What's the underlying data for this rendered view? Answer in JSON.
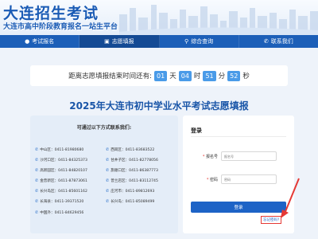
{
  "header": {
    "title": "大连招生考试",
    "subtitle": "大连市高中阶段教育报名一站生平台"
  },
  "nav": [
    {
      "label": "考试报名",
      "icon": "user-icon",
      "active": false
    },
    {
      "label": "志愿填报",
      "icon": "doc-icon",
      "active": true
    },
    {
      "label": "综合查询",
      "icon": "search-icon",
      "active": false
    },
    {
      "label": "联系我们",
      "icon": "phone-icon",
      "active": false
    }
  ],
  "countdown": {
    "prefix": "距离志愿填报结束时间还有:",
    "days": "01",
    "days_unit": "天",
    "hours": "04",
    "hours_unit": "时",
    "minutes": "51",
    "minutes_unit": "分",
    "seconds": "52",
    "seconds_unit": "秒"
  },
  "page_title": "2025年大连市初中学业水平考试志愿填报",
  "contact": {
    "heading": "可通过以下方式联系我们:",
    "items": [
      "中山区：0411-81980680",
      "西岗区：0411-83683522",
      "沙河口区：0411-84325373",
      "甘井子区：0411-82778056",
      "高新园区：0411-84820107",
      "旅顺口区：0411-86387773",
      "金普新区：0411-87873061",
      "普兰店区：0411-83112745",
      "长兴岛区：0411-85601162",
      "庄河市：0411-89812693",
      "长海县：0411-39371520",
      "长兴岛：0411-85089499",
      "中国外：0411-84629456"
    ]
  },
  "login": {
    "title": "登录",
    "username_label": "报名号",
    "username_placeholder": "报名号",
    "password_label": "密码",
    "password_placeholder": "密码",
    "required_mark": "*",
    "submit_label": "登录",
    "forgot_label": "忘记密码?"
  },
  "colors": {
    "brand": "#1c5fb8",
    "countdown_box": "#4a9be8",
    "highlight": "#e53935"
  }
}
